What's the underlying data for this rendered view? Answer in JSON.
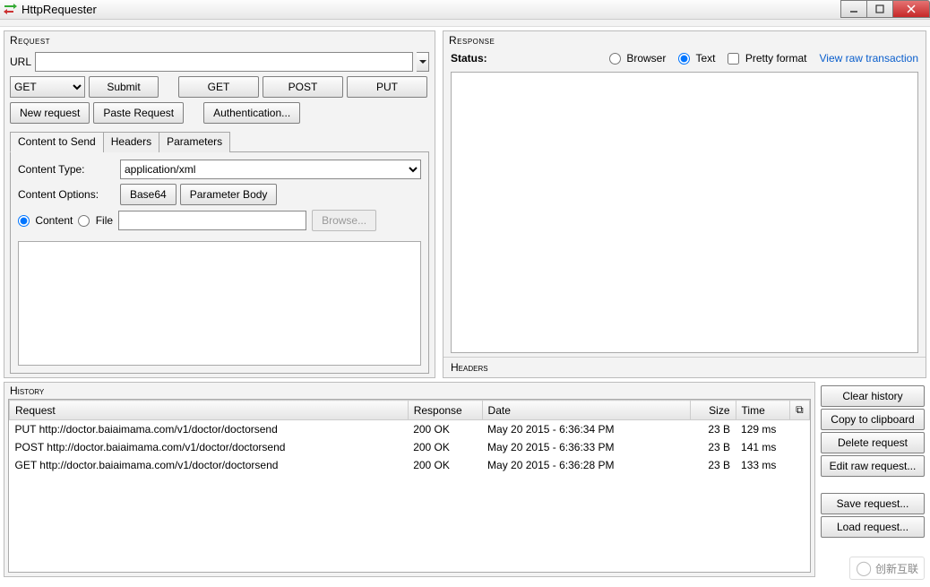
{
  "window": {
    "title": "HttpRequester"
  },
  "request": {
    "label": "Request",
    "url_label": "URL",
    "url_value": "",
    "method_value": "GET",
    "submit_label": "Submit",
    "btn_get": "GET",
    "btn_post": "POST",
    "btn_put": "PUT",
    "new_request": "New request",
    "paste_request": "Paste Request",
    "authentication": "Authentication...",
    "tabs": {
      "content": "Content to Send",
      "headers": "Headers",
      "parameters": "Parameters"
    },
    "content_type_label": "Content Type:",
    "content_type_value": "application/xml",
    "content_options_label": "Content Options:",
    "base64": "Base64",
    "parameter_body": "Parameter Body",
    "radio_content": "Content",
    "radio_file": "File",
    "file_value": "",
    "browse": "Browse..."
  },
  "response": {
    "label": "Response",
    "status_label": "Status:",
    "opt_browser": "Browser",
    "opt_text": "Text",
    "opt_pretty": "Pretty format",
    "view_raw": "View raw transaction",
    "headers_label": "Headers"
  },
  "history": {
    "label": "History",
    "cols": {
      "request": "Request",
      "response": "Response",
      "date": "Date",
      "size": "Size",
      "time": "Time"
    },
    "rows": [
      {
        "request": "PUT http://doctor.baiaimama.com/v1/doctor/doctorsend",
        "response": "200 OK",
        "date": "May 20 2015 - 6:36:34 PM",
        "size": "23 B",
        "time": "129 ms"
      },
      {
        "request": "POST http://doctor.baiaimama.com/v1/doctor/doctorsend",
        "response": "200 OK",
        "date": "May 20 2015 - 6:36:33 PM",
        "size": "23 B",
        "time": "141 ms"
      },
      {
        "request": "GET http://doctor.baiaimama.com/v1/doctor/doctorsend",
        "response": "200 OK",
        "date": "May 20 2015 - 6:36:28 PM",
        "size": "23 B",
        "time": "133 ms"
      }
    ]
  },
  "side": {
    "clear_history": "Clear history",
    "copy_clipboard": "Copy to clipboard",
    "delete_request": "Delete request",
    "edit_raw": "Edit raw request...",
    "save_request": "Save request...",
    "load_request": "Load request..."
  },
  "watermark": "创新互联"
}
